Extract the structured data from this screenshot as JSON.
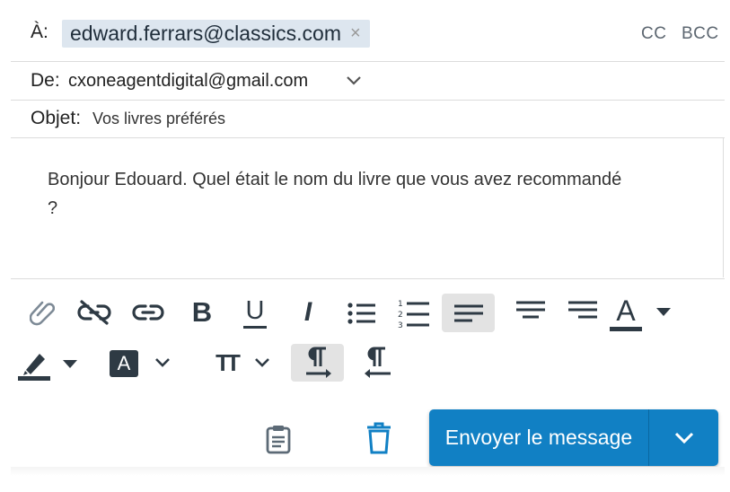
{
  "to": {
    "label": "À:",
    "recipient": "edward.ferrars@classics.com",
    "remove_glyph": "×",
    "cc": "CC",
    "bcc": "BCC"
  },
  "from": {
    "label": "De:",
    "value": "cxoneagentdigital@gmail.com"
  },
  "subject": {
    "label": "Objet:",
    "value": "Vos livres préférés"
  },
  "body": {
    "text": "Bonjour Edouard. Quel était le nom du livre que vous avez recommandé ?"
  },
  "toolbar": {
    "icons": [
      "attach-icon",
      "unlink-icon",
      "link-icon",
      "bold-icon",
      "underline-icon",
      "italic-icon",
      "bullet-list-icon",
      "numbered-list-icon",
      "align-left-icon",
      "align-center-icon",
      "align-right-icon",
      "font-color-icon",
      "highlight-icon",
      "text-background-icon",
      "font-size-icon",
      "ltr-icon",
      "rtl-icon"
    ],
    "bold_glyph": "B",
    "underline_glyph": "U",
    "italic_glyph": "I",
    "font_color_glyph": "A",
    "text_bg_glyph": "A",
    "font_size_glyph": "TT"
  },
  "actions": {
    "send_label": "Envoyer le message"
  },
  "colors": {
    "accent": "#1180c4",
    "chip": "#dde6ef",
    "icon": "#2e3a44",
    "active": "#e3e3e3"
  }
}
